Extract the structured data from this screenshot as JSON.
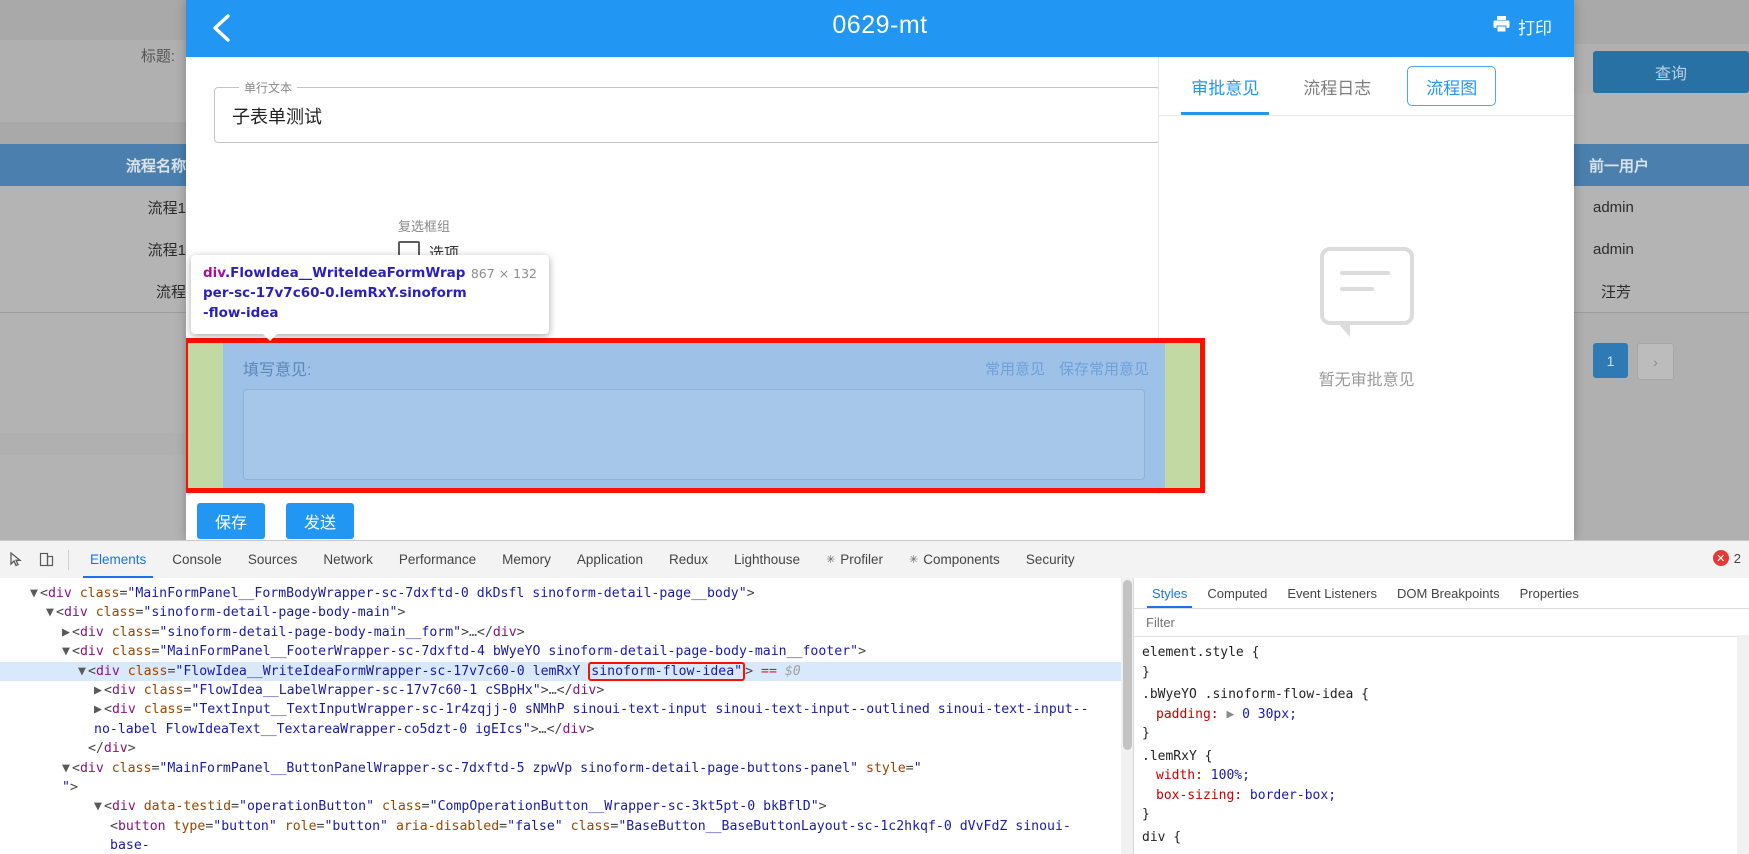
{
  "background": {
    "title_label": "标题:",
    "query_button": "查询",
    "table1": {
      "header": "流程名称",
      "rows": [
        "流程1",
        "流程1",
        "流程"
      ]
    },
    "table2": {
      "header": "前一用户",
      "rows": [
        "admin",
        "admin",
        "汪芳"
      ]
    },
    "pagination": {
      "current": "1",
      "next": "›"
    }
  },
  "modal": {
    "header": {
      "back_icon": "chevron-left-icon",
      "title": "0629-mt",
      "print_icon": "printer-icon",
      "print_label": "打印"
    },
    "form": {
      "single_line": {
        "legend": "单行文本",
        "value": "子表单测试"
      },
      "checkbox_group": {
        "label": "复选框组",
        "option": "选项"
      },
      "buttons": {
        "save": "保存",
        "send": "发送"
      }
    },
    "comment_area": {
      "fill_label": "填写意见:",
      "links": [
        "常用意见",
        "保存常用意见"
      ],
      "textarea_value": ""
    },
    "side": {
      "tabs": [
        {
          "label": "审批意见",
          "active": true,
          "outlined": false
        },
        {
          "label": "流程日志",
          "active": false,
          "outlined": false
        },
        {
          "label": "流程图",
          "active": false,
          "outlined": true
        }
      ],
      "empty_icon": "comment-bubble-icon",
      "empty_text": "暂无审批意见"
    }
  },
  "inspector_tooltip": {
    "tag": "div",
    "classes": ".FlowIdea__WriteIdeaFormWrapper-sc-17v7c60-0.lemRxY.sinoform-flow-idea",
    "line1_tag": "div",
    "line1_cls": ".FlowIdea__WriteIdeaFormWrap",
    "line2": "per-sc-17v7c60-0.lemRxY.sinoform",
    "line3": "-flow-idea",
    "dimensions": "867 × 132"
  },
  "devtools": {
    "toolbar": {
      "inspect_icon": "inspect-cursor-icon",
      "device_icon": "device-toolbar-icon",
      "tabs": [
        {
          "label": "Elements",
          "active": true,
          "dot": ""
        },
        {
          "label": "Console",
          "active": false,
          "dot": ""
        },
        {
          "label": "Sources",
          "active": false,
          "dot": ""
        },
        {
          "label": "Network",
          "active": false,
          "dot": ""
        },
        {
          "label": "Performance",
          "active": false,
          "dot": ""
        },
        {
          "label": "Memory",
          "active": false,
          "dot": ""
        },
        {
          "label": "Application",
          "active": false,
          "dot": ""
        },
        {
          "label": "Redux",
          "active": false,
          "dot": ""
        },
        {
          "label": "Lighthouse",
          "active": false,
          "dot": ""
        },
        {
          "label": "Profiler",
          "active": false,
          "dot": "✳"
        },
        {
          "label": "Components",
          "active": false,
          "dot": "✳"
        },
        {
          "label": "Security",
          "active": false,
          "dot": ""
        }
      ],
      "error_count": "2"
    },
    "dom_lines": [
      "<div class=\"MainFormPanel__FormBodyWrapper-sc-7dxftd-0 dkDsfl sinoform-detail-page__body\">",
      "<div class=\"sinoform-detail-page-body-main\">",
      "<div class=\"sinoform-detail-page-body-main__form\">…</div>",
      "<div class=\"MainFormPanel__FooterWrapper-sc-7dxftd-4 bWyeYO sinoform-detail-page-body-main__footer\">",
      "<div class=\"FlowIdea__WriteIdeaFormWrapper-sc-17v7c60-0 lemRxY sinoform-flow-idea\"> == $0",
      "<div class=\"FlowIdea__LabelWrapper-sc-17v7c60-1 cSBpHx\">…</div>",
      "<div class=\"TextInput__TextInputWrapper-sc-1r4zqjj-0 sNMhP sinoui-text-input sinoui-text-input--outlined sinoui-text-input--no-label FlowIdeaText__TextareaWrapper-co5dzt-0 igEIcs\">…</div>",
      "</div>",
      "<div class=\"MainFormPanel__ButtonPanelWrapper-sc-7dxftd-5 zpwVp sinoform-detail-page-buttons-panel\" style=\"\">",
      "<div data-testid=\"operationButton\" class=\"CompOperationButton__Wrapper-sc-3kt5pt-0 bkBflD\">",
      "<button type=\"button\" role=\"button\" aria-disabled=\"false\" class=\"BaseButton__BaseButtonLayout-sc-1c2hkqf-0 dVvFdZ sinoui-base-"
    ],
    "styles": {
      "tabs": [
        {
          "label": "Styles",
          "active": true
        },
        {
          "label": "Computed",
          "active": false
        },
        {
          "label": "Event Listeners",
          "active": false
        },
        {
          "label": "DOM Breakpoints",
          "active": false
        },
        {
          "label": "Properties",
          "active": false
        }
      ],
      "filter_placeholder": "Filter",
      "rules": [
        {
          "selector": "element.style {",
          "props": [],
          "close": "}"
        },
        {
          "selector": ".bWyeYO .sinoform-flow-idea {",
          "props": [
            {
              "key": "padding:",
              "value": "0 30px;",
              "expand": true
            }
          ],
          "close": "}"
        },
        {
          "selector": ".lemRxY {",
          "props": [
            {
              "key": "width:",
              "value": "100%;",
              "expand": false
            },
            {
              "key": "box-sizing:",
              "value": "border-box;",
              "expand": false
            }
          ],
          "close": "}"
        },
        {
          "selector": "div {",
          "props": [],
          "close": ""
        }
      ]
    }
  },
  "colors": {
    "accent": "#2196f3",
    "devtools_accent": "#1a73e8",
    "highlight_outline": "#fd1000",
    "highlight_content": "#9ec1e8",
    "highlight_padding": "#c2d9a4",
    "table_header": "#4a7fae"
  }
}
